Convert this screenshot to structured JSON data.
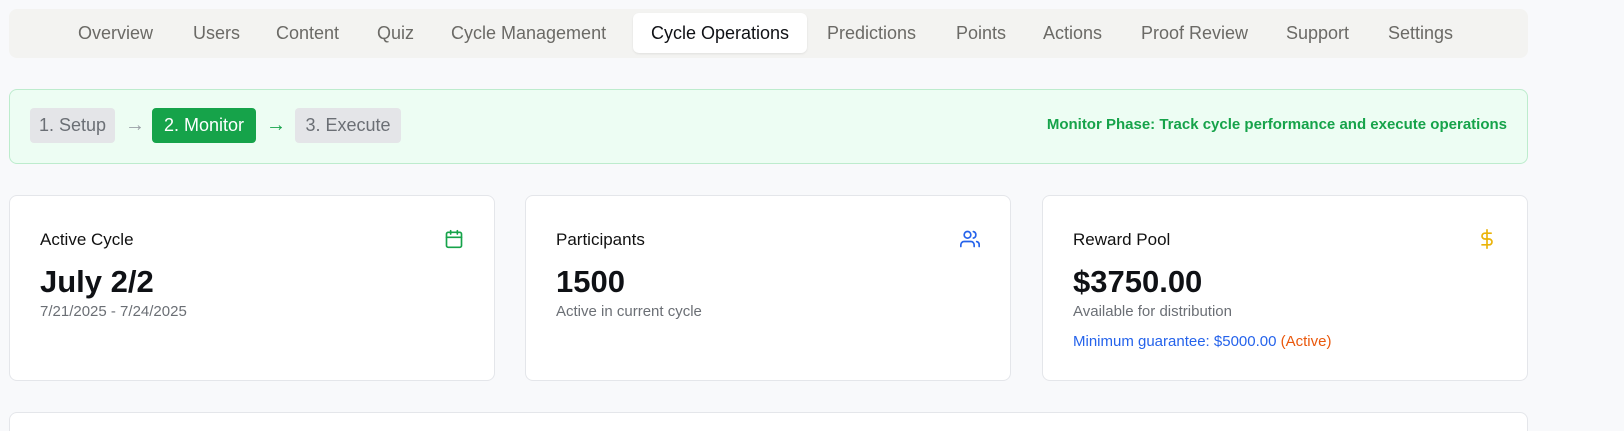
{
  "nav": {
    "tabs": [
      {
        "label": "Overview"
      },
      {
        "label": "Users"
      },
      {
        "label": "Content"
      },
      {
        "label": "Quiz"
      },
      {
        "label": "Cycle Management"
      },
      {
        "label": "Cycle Operations",
        "active": true
      },
      {
        "label": "Predictions"
      },
      {
        "label": "Points"
      },
      {
        "label": "Actions"
      },
      {
        "label": "Proof Review"
      },
      {
        "label": "Support"
      },
      {
        "label": "Settings"
      }
    ]
  },
  "phase": {
    "steps": [
      {
        "label": "1. Setup"
      },
      {
        "label": "2. Monitor",
        "active": true
      },
      {
        "label": "3. Execute"
      }
    ],
    "arrow": "→",
    "description": "Monitor Phase: Track cycle performance and execute operations"
  },
  "cards": {
    "active_cycle": {
      "title": "Active Cycle",
      "value": "July 2/2",
      "sub": "7/21/2025 - 7/24/2025",
      "icon": "calendar-icon"
    },
    "participants": {
      "title": "Participants",
      "value": "1500",
      "sub": "Active in current cycle",
      "icon": "users-icon"
    },
    "reward_pool": {
      "title": "Reward Pool",
      "value": "$3750.00",
      "sub": "Available for distribution",
      "note": "Minimum guarantee: $5000.00",
      "note_status": "(Active)",
      "icon": "dollar-icon"
    }
  },
  "colors": {
    "accent_green": "#16a34a",
    "blue": "#2563eb",
    "orange": "#ea580c",
    "gold": "#eab308"
  }
}
